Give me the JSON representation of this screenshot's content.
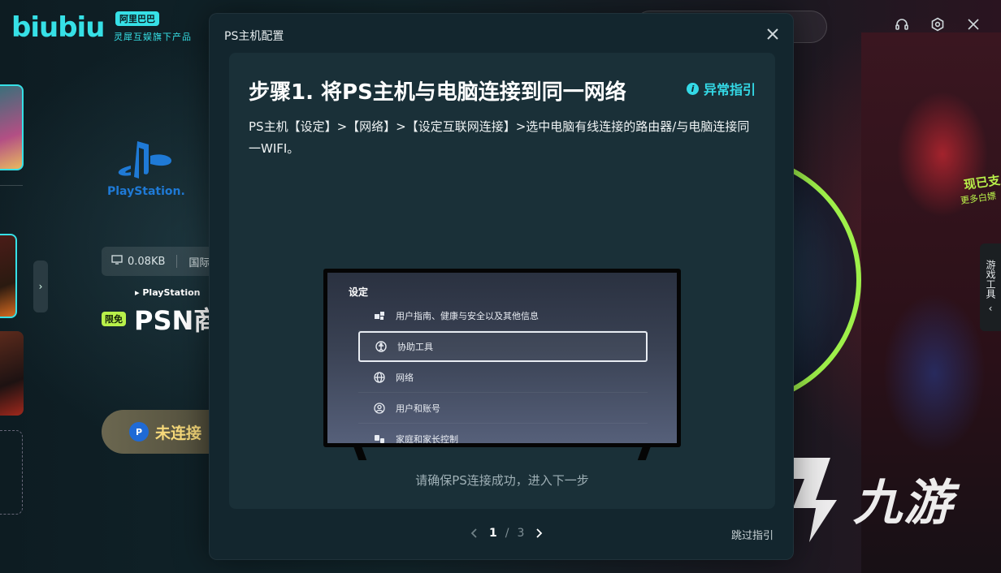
{
  "app": {
    "logo": "biubiu",
    "logo_badge": "阿里巴巴",
    "logo_sub": "灵犀互娱旗下产品"
  },
  "top_bar": {
    "icons": [
      "headset-icon",
      "settings-icon",
      "close-icon"
    ]
  },
  "game_panel": {
    "brand": "PlayStation.",
    "stat_speed": "0.08KB",
    "stat_region": "国际",
    "psn_brand": "PlayStation",
    "free_badge": "限免",
    "title": "PSN商",
    "connect_status": "未连接",
    "side_tab": "游戏工具"
  },
  "promo": {
    "headline": "现已支",
    "sub": "更多白嫖"
  },
  "watermark": {
    "text": "九游"
  },
  "modal": {
    "title": "PS主机配置",
    "step_title": "步骤1. 将PS主机与电脑连接到同一网络",
    "help_label": "异常指引",
    "step_description": "PS主机【设定】>【网络】>【设定互联网连接】>选中电脑有线连接的路由器/与电脑连接同一WIFI。",
    "tv_screen": {
      "heading": "设定",
      "items": [
        {
          "label": "用户指南、健康与安全以及其他信息",
          "icon": "info-icon"
        },
        {
          "label": "协助工具",
          "icon": "accessibility-icon",
          "selected": true
        },
        {
          "label": "网络",
          "icon": "globe-icon"
        },
        {
          "label": "用户和账号",
          "icon": "user-icon"
        },
        {
          "label": "家庭和家长控制",
          "icon": "family-icon"
        }
      ]
    },
    "hint": "请确保PS连接成功，进入下一步",
    "pager": {
      "current": "1",
      "separator": "/",
      "total": "3"
    },
    "skip_label": "跳过指引"
  }
}
